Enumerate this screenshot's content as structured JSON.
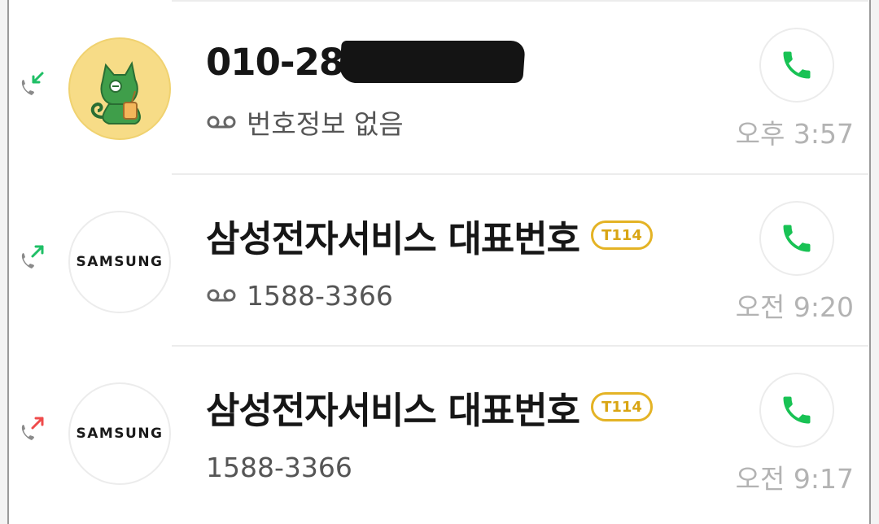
{
  "colors": {
    "incoming_arrow": "#1fbf66",
    "outgoing_arrow": "#1fbf66",
    "missed_arrow": "#ef4b4b",
    "call_button": "#18c254",
    "tag_border": "#e4b325"
  },
  "calls": [
    {
      "direction": "incoming",
      "direction_icon": "incoming-call-icon",
      "avatar": "cat-avatar",
      "name": "010-28",
      "name_redacted": true,
      "voicemail": true,
      "subtitle": "번호정보 없음",
      "time": "오후 3:57"
    },
    {
      "direction": "outgoing",
      "direction_icon": "outgoing-call-icon",
      "avatar": "samsung-logo",
      "avatar_text": "SAMSUNG",
      "name": "삼성전자서비스 대표번호",
      "tag": "T114",
      "voicemail": true,
      "subtitle": "1588-3366",
      "time": "오전 9:20"
    },
    {
      "direction": "outgoing-unanswered",
      "direction_icon": "outgoing-unanswered-call-icon",
      "avatar": "samsung-logo",
      "avatar_text": "SAMSUNG",
      "name": "삼성전자서비스 대표번호",
      "tag": "T114",
      "voicemail": false,
      "subtitle": "1588-3366",
      "time": "오전 9:17"
    }
  ]
}
